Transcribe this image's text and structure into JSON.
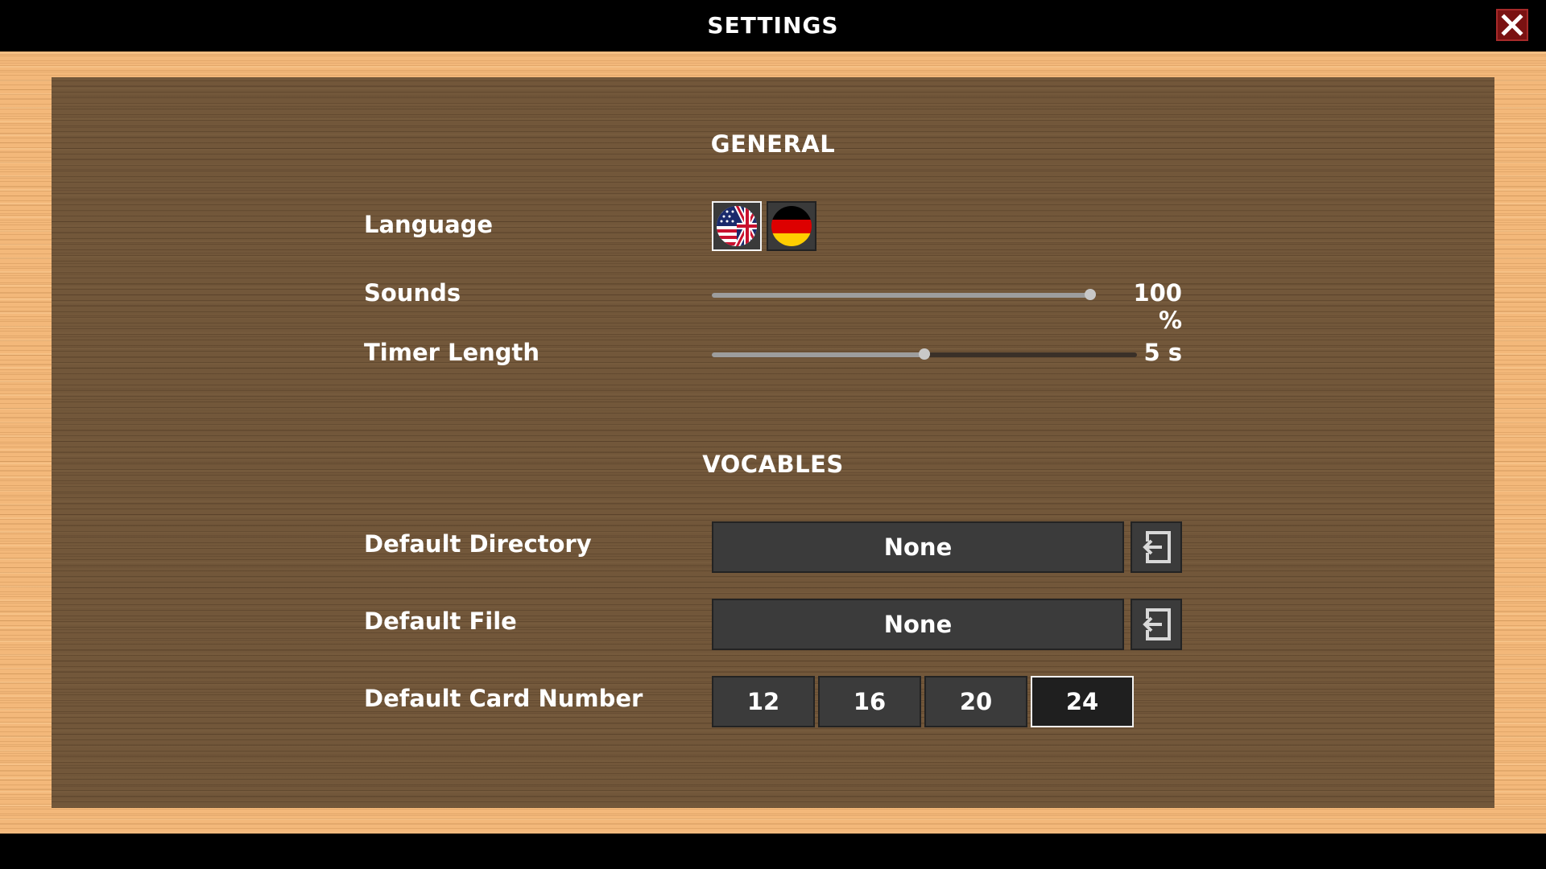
{
  "window": {
    "title": "SETTINGS",
    "close_icon": "close-icon"
  },
  "general": {
    "title": "GENERAL",
    "language": {
      "label": "Language",
      "options": [
        {
          "name": "english",
          "icon": "uk-us-flag-icon",
          "selected": true
        },
        {
          "name": "german",
          "icon": "german-flag-icon",
          "selected": false
        }
      ]
    },
    "sounds": {
      "label": "Sounds",
      "value_text": "100 %",
      "level": 1.0
    },
    "timer": {
      "label": "Timer Length",
      "value_text": "5 s",
      "level": 0.5
    }
  },
  "vocables": {
    "title": "VOCABLES",
    "default_directory": {
      "label": "Default Directory",
      "value": "None",
      "icon": "folder-open-icon"
    },
    "default_file": {
      "label": "Default File",
      "value": "None",
      "icon": "file-open-icon"
    },
    "card_number": {
      "label": "Default Card Number",
      "options": [
        "12",
        "16",
        "20",
        "24"
      ],
      "selected": "24"
    }
  }
}
